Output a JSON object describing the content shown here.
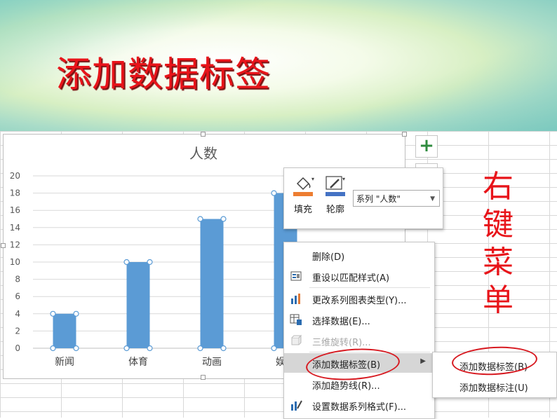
{
  "slide": {
    "title": "添加数据标签",
    "side_note": "右键菜单"
  },
  "chart_data": {
    "type": "bar",
    "title": "人数",
    "categories": [
      "新闻",
      "体育",
      "动画",
      "娱乐"
    ],
    "visible_category_labels": [
      "新闻",
      "体育",
      "动画",
      "娱乐"
    ],
    "series": [
      {
        "name": "人数",
        "values": [
          4,
          10,
          15,
          18
        ]
      }
    ],
    "ylim": [
      0,
      20
    ],
    "yticks": [
      0,
      2,
      4,
      6,
      8,
      10,
      12,
      14,
      16,
      18,
      20
    ],
    "bar_color": "#5b9bd5",
    "grid": true,
    "selected": true
  },
  "float_toolbar": {
    "fill_label": "填充",
    "outline_label": "轮廓",
    "series_select_value": "系列 \"人数\"",
    "fill_color": "#ed7d31",
    "outline_color": "#4472c4"
  },
  "context_menu": {
    "items": [
      {
        "label": "删除(D)",
        "icon": "none",
        "enabled": true
      },
      {
        "label": "重设以匹配样式(A)",
        "icon": "reset-style-icon",
        "enabled": true
      },
      {
        "label": "更改系列图表类型(Y)...",
        "icon": "chart-type-icon",
        "enabled": true
      },
      {
        "label": "选择数据(E)...",
        "icon": "select-data-icon",
        "enabled": true
      },
      {
        "label": "三维旋转(R)...",
        "icon": "rotate-3d-icon",
        "enabled": false
      },
      {
        "label": "添加数据标签(B)",
        "icon": "none",
        "enabled": true,
        "submenu": true,
        "highlighted": true
      },
      {
        "label": "添加趋势线(R)...",
        "icon": "none",
        "enabled": true
      },
      {
        "label": "设置数据系列格式(F)...",
        "icon": "format-series-icon",
        "enabled": true
      }
    ]
  },
  "submenu": {
    "items": [
      {
        "label": "添加数据标签(B)"
      },
      {
        "label": "添加数据标注(U)"
      }
    ]
  },
  "chart_buttons": {
    "add_element": "+"
  }
}
